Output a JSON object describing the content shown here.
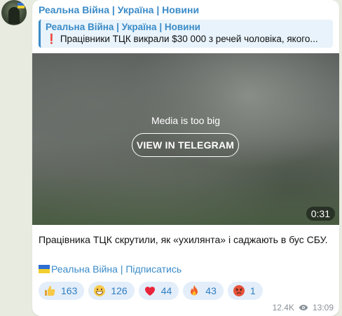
{
  "channel": {
    "name": "Реальна Війна | Україна | Новини"
  },
  "reply": {
    "title": "Реальна Війна | Україна | Новини",
    "emoji": "❗",
    "text": "Працівники ТЦК викрали $30 000 з речей чоловіка, якого..."
  },
  "media": {
    "message": "Media is too big",
    "button_label": "VIEW IN TELEGRAM",
    "duration": "0:31"
  },
  "caption": "Працівника ТЦК скрутили, як «ухилянта» і саджають в бус СБУ.",
  "subscribe_link": "Реальна Війна | Підписатись",
  "reactions": [
    {
      "emoji": "thumbs-up",
      "count": "163"
    },
    {
      "emoji": "grinning-face",
      "count": "126"
    },
    {
      "emoji": "red-heart",
      "count": "44"
    },
    {
      "emoji": "fire",
      "count": "43"
    },
    {
      "emoji": "angry-face",
      "count": "1"
    }
  ],
  "meta": {
    "views": "12.4K",
    "time": "13:09"
  },
  "colors": {
    "accent": "#3a8bc8",
    "reaction_bg": "#e3eefa",
    "chat_bg": "#e7ebe0"
  }
}
